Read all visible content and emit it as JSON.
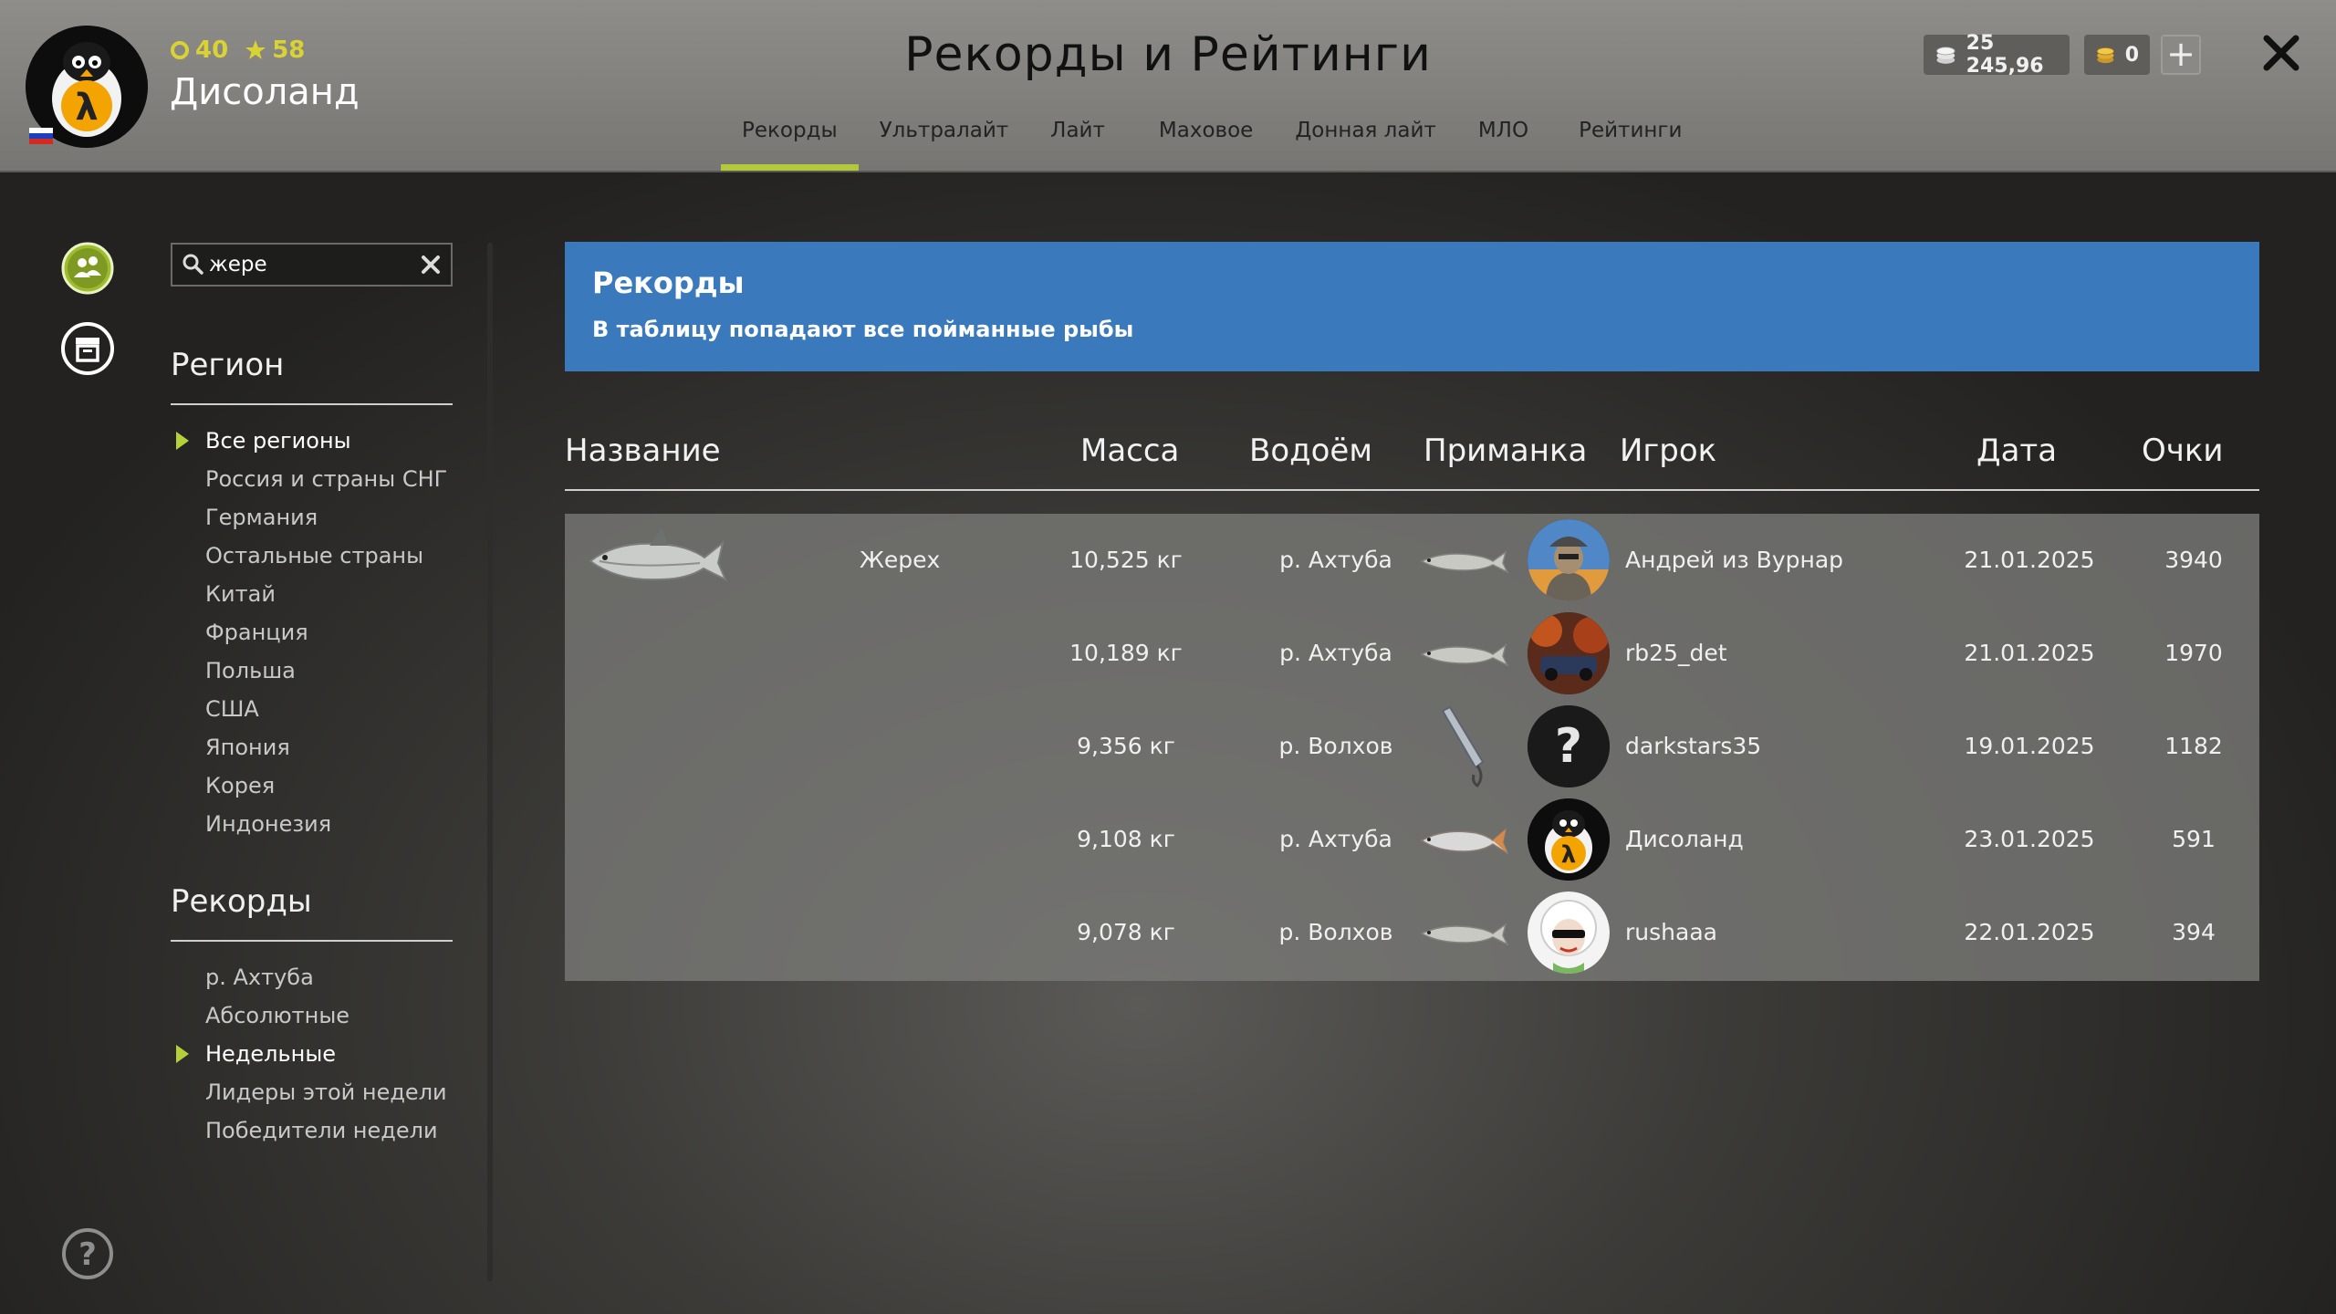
{
  "header": {
    "title": "Рекорды и Рейтинги",
    "player": {
      "name": "Дисоланд",
      "level": "40",
      "stars": "58"
    },
    "currency": {
      "silver": "25 245,96",
      "gold": "0"
    },
    "tabs": [
      {
        "label": "Рекорды",
        "active": true
      },
      {
        "label": "Ультралайт"
      },
      {
        "label": "Лайт"
      },
      {
        "label": "Маховое"
      },
      {
        "label": "Донная лайт"
      },
      {
        "label": "МЛО"
      },
      {
        "label": "Рейтинги"
      }
    ]
  },
  "sidebar": {
    "search": {
      "value": "жере"
    },
    "region_title": "Регион",
    "regions": [
      {
        "label": "Все регионы",
        "active": true
      },
      {
        "label": "Россия и страны СНГ"
      },
      {
        "label": "Германия"
      },
      {
        "label": "Остальные страны"
      },
      {
        "label": "Китай"
      },
      {
        "label": "Франция"
      },
      {
        "label": "Польша"
      },
      {
        "label": "США"
      },
      {
        "label": "Япония"
      },
      {
        "label": "Корея"
      },
      {
        "label": "Индонезия"
      }
    ],
    "records_title": "Рекорды",
    "records": [
      {
        "label": "р. Ахтуба"
      },
      {
        "label": "Абсолютные"
      },
      {
        "label": "Недельные",
        "active": true
      },
      {
        "label": "Лидеры этой недели"
      },
      {
        "label": "Победители недели"
      }
    ]
  },
  "banner": {
    "title": "Рекорды",
    "subtitle": "В таблицу попадают все пойманные рыбы"
  },
  "table": {
    "headers": {
      "name": "Название",
      "mass": "Масса",
      "water": "Водоём",
      "bait": "Приманка",
      "player": "Игрок",
      "date": "Дата",
      "points": "Очки"
    },
    "fish_name": "Жерех",
    "rows": [
      {
        "mass": "10,525 кг",
        "water": "р. Ахтуба",
        "player": "Андрей из Вурнар",
        "date": "21.01.2025",
        "points": "3940",
        "bait_icon": "fish-bait-icon",
        "avatar_icon": "player-avatar-hat-icon"
      },
      {
        "mass": "10,189 кг",
        "water": "р. Ахтуба",
        "player": "rb25_det",
        "date": "21.01.2025",
        "points": "1970",
        "bait_icon": "fish-bait-icon",
        "avatar_icon": "player-avatar-car-icon"
      },
      {
        "mass": "9,356 кг",
        "water": "р. Волхов",
        "player": "darkstars35",
        "date": "19.01.2025",
        "points": "1182",
        "bait_icon": "spoon-lure-icon",
        "avatar_icon": "unknown-avatar-icon"
      },
      {
        "mass": "9,108 кг",
        "water": "р. Ахтуба",
        "player": "Дисоланд",
        "date": "23.01.2025",
        "points": "591",
        "bait_icon": "fish-bait-icon",
        "avatar_icon": "penguin-avatar-icon"
      },
      {
        "mass": "9,078 кг",
        "water": "р. Волхов",
        "player": "rushaaa",
        "date": "22.01.2025",
        "points": "394",
        "bait_icon": "fish-bait-icon",
        "avatar_icon": "sheep-avatar-icon"
      }
    ]
  },
  "colors": {
    "accent": "#b3c93a",
    "banner": "#3a79bc",
    "level_text": "#d9d235"
  }
}
